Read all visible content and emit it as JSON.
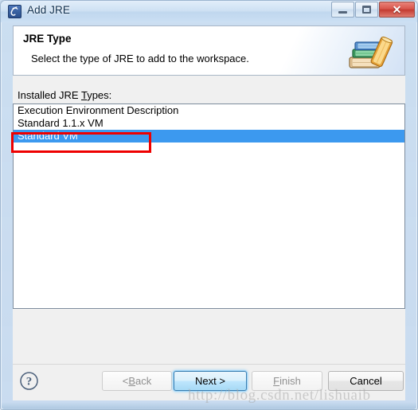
{
  "window": {
    "title": "Add JRE",
    "icon": "java-jre-icon",
    "controls": {
      "minimize": "minimize-button",
      "maximize": "restore-button",
      "close": "close-button"
    }
  },
  "header": {
    "title": "JRE Type",
    "description": "Select the type of JRE to add to the workspace.",
    "banner_icon": "books-stack-icon"
  },
  "main": {
    "list_label": "Installed JRE ",
    "list_label_accel": "T",
    "list_label_suffix": "ypes:",
    "list": {
      "name": "installed-jre-types-list",
      "items": [
        {
          "label": "Execution Environment Description",
          "selected": false
        },
        {
          "label": "Standard 1.1.x VM",
          "selected": false
        },
        {
          "label": "Standard VM",
          "selected": true
        }
      ]
    }
  },
  "annotation": {
    "type": "red-rectangle-highlight",
    "target": "Standard VM",
    "color": "#ee0000"
  },
  "footer": {
    "help_icon": "help-question-icon",
    "buttons": [
      {
        "id": "back",
        "label": "< ",
        "accel": "B",
        "suffix": "ack",
        "state": "disabled"
      },
      {
        "id": "next",
        "label": "Next >",
        "state": "default"
      },
      {
        "id": "finish",
        "label": "",
        "accel": "F",
        "suffix": "inish",
        "state": "disabled"
      },
      {
        "id": "cancel",
        "label": "Cancel",
        "state": "enabled"
      }
    ]
  },
  "watermark": {
    "text": "http://blog.csdn.net/lishuaib"
  },
  "colors": {
    "selection_blue": "#3c99ef",
    "annotation_red": "#ee0000",
    "dialog_gray": "#f0f0f0",
    "titlebar_blue": "#cde0f3"
  }
}
